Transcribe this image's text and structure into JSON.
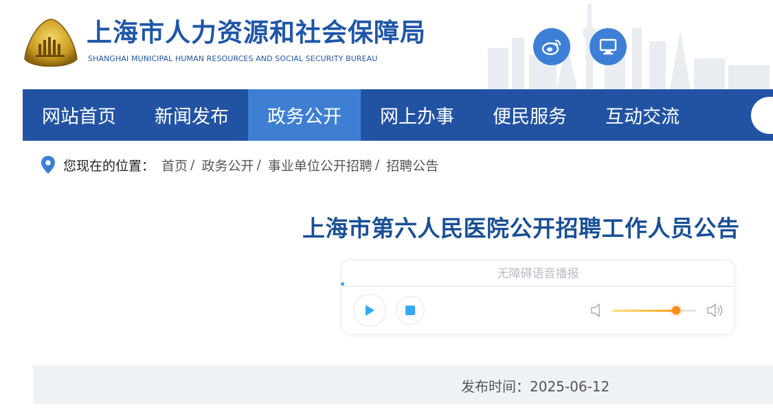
{
  "header": {
    "title": "上海市人力资源和社会保障局",
    "subtitle": "SHANGHAI MUNICIPAL HUMAN RESOURCES AND SOCIAL SECURITY BUREAU",
    "icons": [
      "weibo-icon",
      "monitor-icon"
    ],
    "brand_color": "#1f56a8"
  },
  "nav": {
    "items": [
      {
        "label": "网站首页",
        "active": false
      },
      {
        "label": "新闻发布",
        "active": false
      },
      {
        "label": "政务公开",
        "active": true
      },
      {
        "label": "网上办事",
        "active": false
      },
      {
        "label": "便民服务",
        "active": false
      },
      {
        "label": "互动交流",
        "active": false
      }
    ],
    "bar_color": "#2253a3",
    "active_color": "#3e7fd4"
  },
  "breadcrumb": {
    "prefix": "您现在的位置：",
    "items": [
      "首页",
      "政务公开",
      "事业单位公开招聘",
      "招聘公告"
    ],
    "separator": "/"
  },
  "article": {
    "title": "上海市第六人民医院公开招聘工作人员公告",
    "player": {
      "label": "无障碍语音播报",
      "volume": 0.76
    },
    "publish_label": "发布时间：",
    "publish_date": "2025-06-12"
  }
}
